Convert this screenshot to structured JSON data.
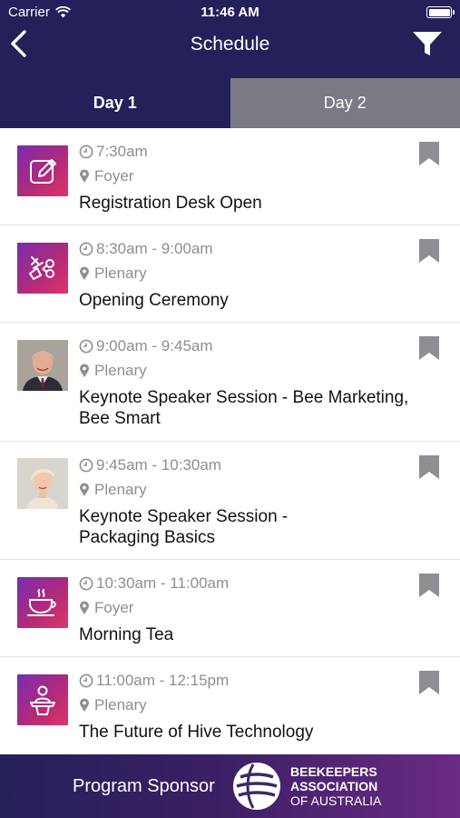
{
  "status": {
    "carrier": "Carrier",
    "time": "11:46 AM"
  },
  "nav": {
    "title": "Schedule"
  },
  "tabs": [
    {
      "label": "Day 1",
      "active": true
    },
    {
      "label": "Day 2",
      "active": false
    }
  ],
  "events": [
    {
      "time": "7:30am",
      "location": "Foyer",
      "title": "Registration Desk Open",
      "thumb": "pencil-icon"
    },
    {
      "time": "8:30am - 9:00am",
      "location": "Plenary",
      "title": "Opening Ceremony",
      "thumb": "ribbon-cut-icon"
    },
    {
      "time": "9:00am - 9:45am",
      "location": "Plenary",
      "title": "Keynote Speaker Session - Bee Marketing, Bee Smart",
      "thumb": "speaker-photo-male"
    },
    {
      "time": "9:45am - 10:30am",
      "location": "Plenary",
      "title": "Keynote Speaker Session - Packaging Basics",
      "thumb": "speaker-photo-female"
    },
    {
      "time": "10:30am - 11:00am",
      "location": "Foyer",
      "title": "Morning Tea",
      "thumb": "teacup-icon"
    },
    {
      "time": "11:00am - 12:15pm",
      "location": "Plenary",
      "title": "The Future of Hive Technology",
      "thumb": "podium-speaker-icon"
    }
  ],
  "footer": {
    "label": "Program Sponsor",
    "sponsor_line1": "BEEKEEPERS",
    "sponsor_line2": "ASSOCIATION",
    "sponsor_line3": "OF AUSTRALIA"
  },
  "colors": {
    "header": "#24205a",
    "tab_inactive": "#7b7a84",
    "accent_gradient_start": "#7a2db0",
    "accent_gradient_end": "#e0336a",
    "meta_gray": "#8e8e93"
  }
}
